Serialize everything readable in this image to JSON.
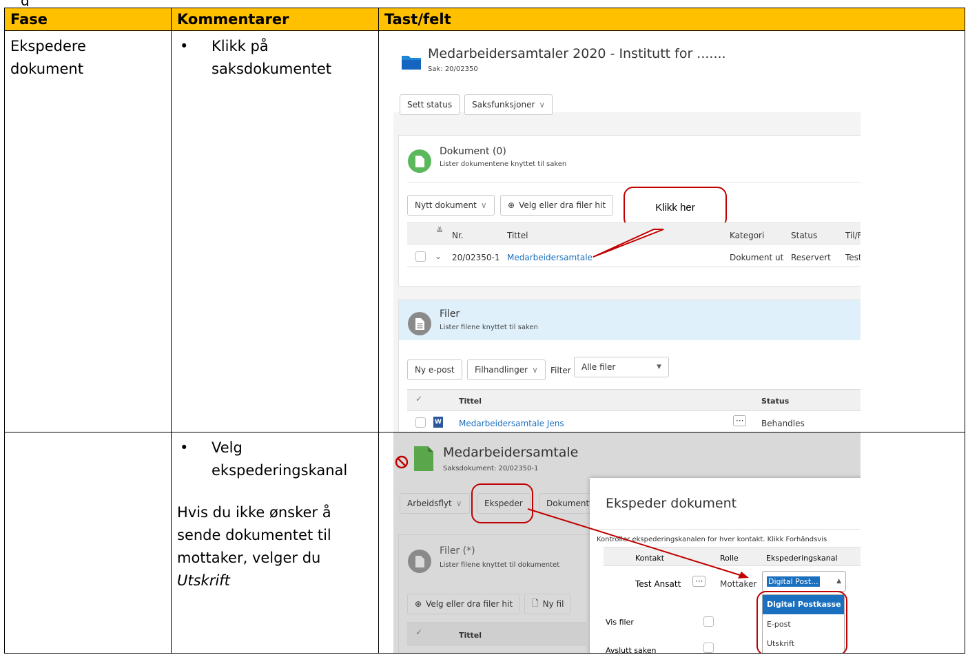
{
  "header": {
    "col1": "Fase",
    "col2": "Kommentarer",
    "col3": "Tast/felt"
  },
  "row1": {
    "fase": "Ekspedere dokument",
    "bullet": "Klikk på saksdokumentet",
    "shot": {
      "case_title": "Medarbeidersamtaler 2020 - Institutt for .......",
      "case_no": "Sak: 20/02350",
      "btn_status": "Sett status",
      "btn_funcs": "Saksfunksjoner",
      "doc_title": "Dokument (0)",
      "doc_sub": "Lister dokumentene knyttet til saken",
      "btn_new_doc": "Nytt dokument",
      "btn_choose_files": "Velg eller dra filer hit",
      "callout": "Klikk her",
      "cols": {
        "nr": "Nr.",
        "title": "Tittel",
        "category": "Kategori",
        "status": "Status",
        "tofrom": "Til/Fra"
      },
      "row": {
        "nr": "20/02350-1",
        "title": "Medarbeidersamtale",
        "category": "Dokument ut",
        "status": "Reservert",
        "tofrom": "Test A"
      },
      "files_title": "Filer",
      "files_sub": "Lister filene knyttet til saken",
      "btn_new_email": "Ny e-post",
      "btn_file_actions": "Filhandlinger",
      "filter_label": "Filter",
      "filter_value": "Alle filer",
      "files_cols": {
        "title": "Tittel",
        "status": "Status"
      },
      "file_row": {
        "title": "Medarbeidersamtale Jens",
        "status": "Behandles"
      }
    }
  },
  "row2": {
    "fase": "",
    "bullet": "Velg ekspederingskanal",
    "para_prefix": "Hvis du ikke ønsker å sende dokumentet til mottaker, velger du ",
    "para_em": "Utskrift",
    "shot": {
      "doc_title": "Medarbeidersamtale",
      "doc_sub": "Saksdokument: 20/02350-1",
      "btn_workflow": "Arbeidsflyt",
      "btn_dispatch": "Ekspeder",
      "btn_docfunc": "Dokumentf",
      "files_title": "Filer (*)",
      "files_sub": "Lister filene knyttet til dokumentet",
      "btn_choose_files": "Velg eller dra filer hit",
      "btn_new_file": "Ny fil",
      "col_title": "Tittel",
      "dialog_title": "Ekspeder dokument",
      "dialog_text": "Kontroller ekspederingskanalen for hver kontakt. Klikk Forhåndsvis",
      "col_contact": "Kontakt",
      "col_role": "Rolle",
      "col_channel": "Ekspederingskanal",
      "contact": "Test Ansatt",
      "role": "Mottaker",
      "channel_value": "Digital Post...",
      "options": [
        "Digital Postkasse",
        "E-post",
        "Utskrift"
      ],
      "show_files": "Vis filer",
      "close_case": "Avslutt saken"
    }
  },
  "colors": {
    "header_bg": "#ffc000",
    "callout": "#c00000",
    "link": "#1a6fbf",
    "selected": "#1a6fbf"
  }
}
